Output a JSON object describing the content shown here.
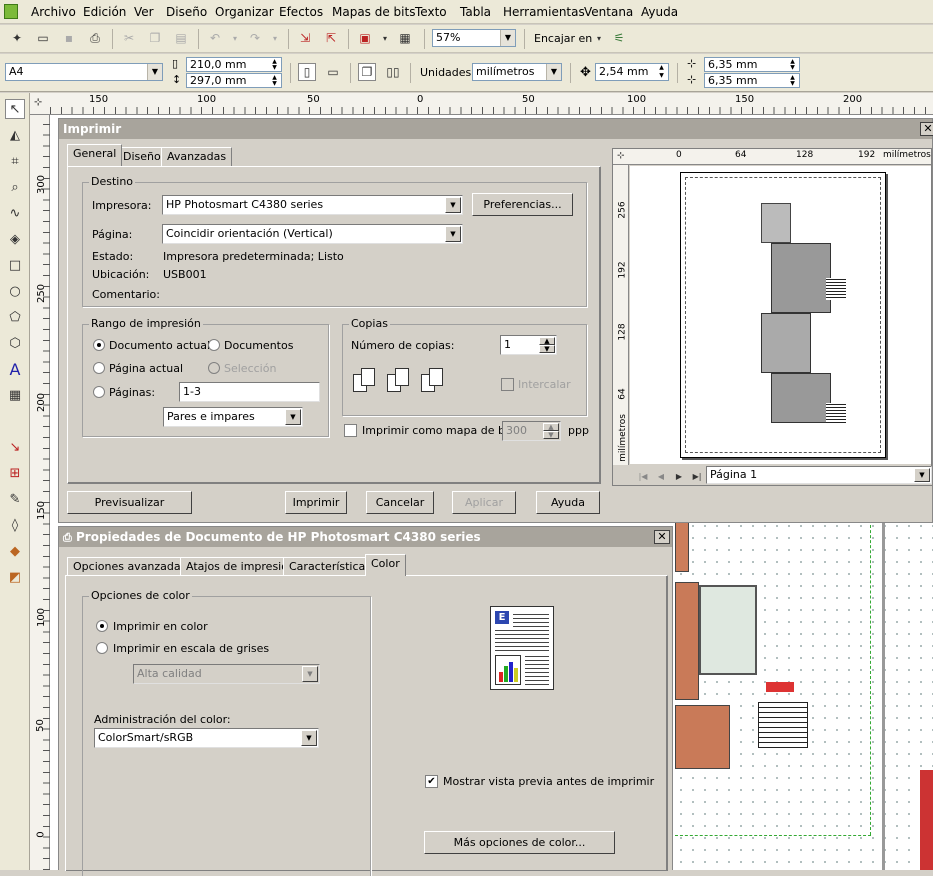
{
  "menu": [
    "Archivo",
    "Edición",
    "Ver",
    "Diseño",
    "Organizar",
    "Efectos",
    "Mapas de bits",
    "Texto",
    "Tabla",
    "Herramientas",
    "Ventana",
    "Ayuda"
  ],
  "toolbar": {
    "zoom": "57%",
    "snap_label": "Encajar en"
  },
  "propbar": {
    "paper": "A4",
    "width": "210,0 mm",
    "height": "297,0 mm",
    "units_label": "Unidades:",
    "units": "milímetros",
    "nudge": "2,54 mm",
    "dup_x": "6,35 mm",
    "dup_y": "6,35 mm"
  },
  "hruler_ticks": [
    "150",
    "100",
    "50",
    "0",
    "50",
    "100",
    "150",
    "200"
  ],
  "vruler_ticks": [
    "300",
    "250",
    "200",
    "150",
    "100",
    "50",
    "0"
  ],
  "print_dialog": {
    "title": "Imprimir",
    "tabs": [
      "General",
      "Diseño",
      "Avanzadas"
    ],
    "destino": {
      "group": "Destino",
      "printer_label": "Impresora:",
      "printer": "HP Photosmart C4380 series",
      "prefs_button": "Preferencias...",
      "page_label": "Página:",
      "page": "Coincidir orientación (Vertical)",
      "status_label": "Estado:",
      "status": "Impresora predeterminada; Listo",
      "location_label": "Ubicación:",
      "location": "USB001",
      "comment_label": "Comentario:"
    },
    "rango": {
      "group": "Rango de impresión",
      "current_doc": "Documento actual",
      "documents": "Documentos",
      "current_page": "Página actual",
      "selection": "Selección",
      "pages": "Páginas:",
      "pages_value": "1-3",
      "parity": "Pares e impares"
    },
    "copias": {
      "group": "Copias",
      "copies_label": "Número de copias:",
      "copies": "1",
      "collate": "Intercalar"
    },
    "bitmap": {
      "label": "Imprimir como mapa de bits:",
      "dpi": "300",
      "unit": "ppp"
    },
    "preview": {
      "ruler_ticks": [
        "0",
        "64",
        "128",
        "192"
      ],
      "ruler_unit": "milímetros",
      "v_ticks": [
        "256",
        "192",
        "128",
        "64"
      ],
      "v_unit": "milímetros",
      "page_select": "Página 1"
    },
    "buttons": {
      "preview": "Previsualizar",
      "print": "Imprimir",
      "cancel": "Cancelar",
      "apply": "Aplicar",
      "help": "Ayuda"
    }
  },
  "props_dialog": {
    "title": "Propiedades de Documento de HP Photosmart C4380 series",
    "tabs": [
      "Opciones avanzadas",
      "Atajos de impresión",
      "Características",
      "Color"
    ],
    "color_group": "Opciones de color",
    "color_opt": "Imprimir en color",
    "gray_opt": "Imprimir en escala de grises",
    "quality": "Alta calidad",
    "mgmt_label": "Administración del color:",
    "mgmt_value": "ColorSmart/sRGB",
    "show_preview": "Mostrar vista previa antes de imprimir",
    "more_color": "Más opciones de color..."
  }
}
